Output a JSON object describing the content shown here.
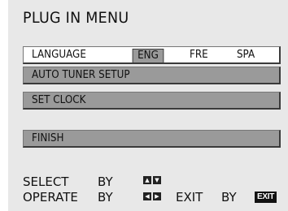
{
  "menu": {
    "title": "PLUG IN MENU",
    "language": {
      "label": "LANGUAGE",
      "options": [
        "ENG",
        "FRE",
        "SPA"
      ],
      "selected": "ENG"
    },
    "auto_tuner_label": "AUTO TUNER SETUP",
    "set_clock_label": "SET CLOCK",
    "finish_label": "FINISH"
  },
  "help": {
    "select_text": "SELECT",
    "select_by": "BY",
    "operate_text": "OPERATE",
    "operate_by": "BY",
    "exit_text": "EXIT",
    "exit_by": "BY",
    "exit_key_label": "EXIT",
    "up_down_icon": "up-down-arrow-keys",
    "left_right_icon": "left-right-arrow-keys"
  },
  "colors": {
    "background": "#e8e8e8",
    "bar": "#9a9a9a",
    "selected_bar": "#ffffff"
  }
}
